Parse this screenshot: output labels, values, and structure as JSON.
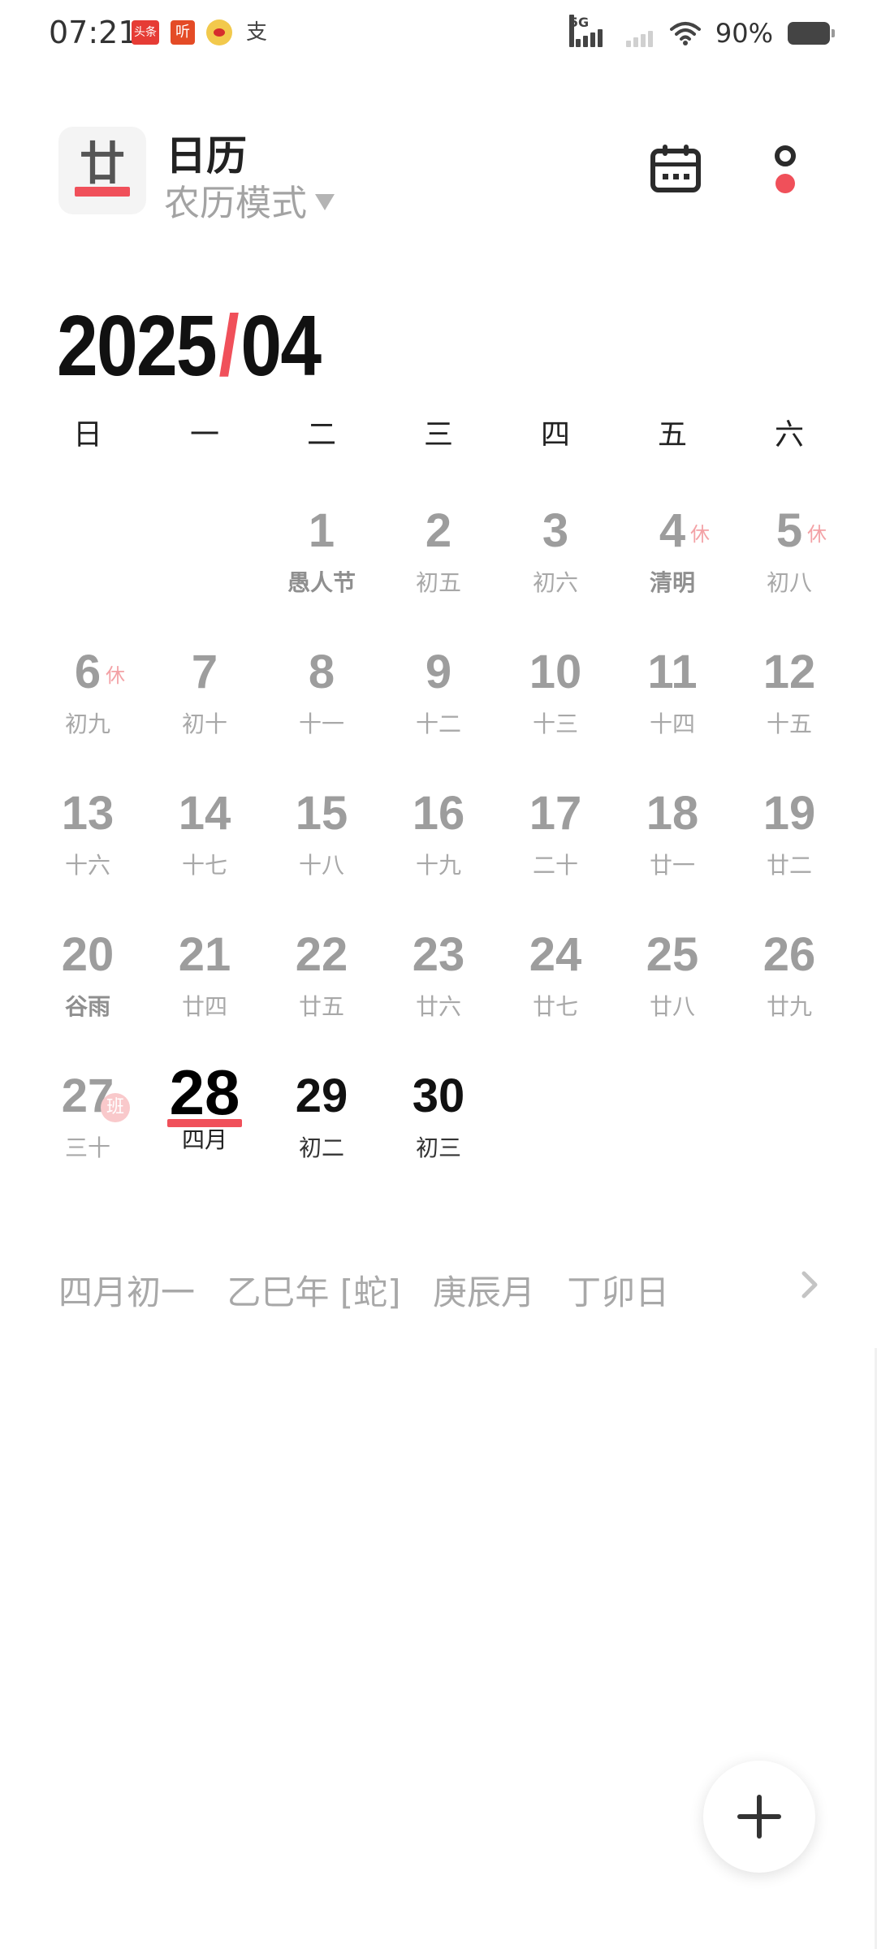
{
  "status_bar": {
    "time": "07:21",
    "apps": [
      {
        "name": "toutiao",
        "label": "头条",
        "color": "#e63c35"
      },
      {
        "name": "ting",
        "label": "听",
        "color": "#e44b26"
      },
      {
        "name": "weibo-icon",
        "label": ""
      },
      {
        "name": "alipay",
        "label": "支"
      }
    ],
    "network": "5G",
    "battery": "90%"
  },
  "header": {
    "logo_text": "廿",
    "title": "日历",
    "mode": "农历模式"
  },
  "month": {
    "year": "2025",
    "separator": "/",
    "month": "04"
  },
  "weekdays": [
    "日",
    "一",
    "二",
    "三",
    "四",
    "五",
    "六"
  ],
  "calendar": {
    "days": [
      {
        "day": "1",
        "sub": "愚人节",
        "holiday": true
      },
      {
        "day": "2",
        "sub": "初五"
      },
      {
        "day": "3",
        "sub": "初六"
      },
      {
        "day": "4",
        "sub": "清明",
        "holiday": true,
        "tag": "休"
      },
      {
        "day": "5",
        "sub": "初八",
        "tag": "休"
      },
      {
        "day": "6",
        "sub": "初九",
        "tag": "休"
      },
      {
        "day": "7",
        "sub": "初十"
      },
      {
        "day": "8",
        "sub": "十一"
      },
      {
        "day": "9",
        "sub": "十二"
      },
      {
        "day": "10",
        "sub": "十三"
      },
      {
        "day": "11",
        "sub": "十四"
      },
      {
        "day": "12",
        "sub": "十五"
      },
      {
        "day": "13",
        "sub": "十六"
      },
      {
        "day": "14",
        "sub": "十七"
      },
      {
        "day": "15",
        "sub": "十八"
      },
      {
        "day": "16",
        "sub": "十九"
      },
      {
        "day": "17",
        "sub": "二十"
      },
      {
        "day": "18",
        "sub": "廿一"
      },
      {
        "day": "19",
        "sub": "廿二"
      },
      {
        "day": "20",
        "sub": "谷雨",
        "holiday": true
      },
      {
        "day": "21",
        "sub": "廿四"
      },
      {
        "day": "22",
        "sub": "廿五"
      },
      {
        "day": "23",
        "sub": "廿六"
      },
      {
        "day": "24",
        "sub": "廿七"
      },
      {
        "day": "25",
        "sub": "廿八"
      },
      {
        "day": "26",
        "sub": "廿九"
      },
      {
        "day": "27",
        "sub": "三十",
        "work_badge": "班"
      },
      {
        "day": "28",
        "sub": "四月",
        "today": true
      },
      {
        "day": "29",
        "sub": "初二",
        "current": true
      },
      {
        "day": "30",
        "sub": "初三",
        "current": true
      }
    ],
    "first_weekday": 2
  },
  "lunar_info": {
    "parts": [
      "四月初一",
      "乙巳年 [蛇]",
      "庚辰月",
      "丁卯日"
    ]
  },
  "colors": {
    "accent": "#f0505a",
    "muted_text": "#9d9d9d",
    "holiday_tag": "#f3a2a6"
  }
}
